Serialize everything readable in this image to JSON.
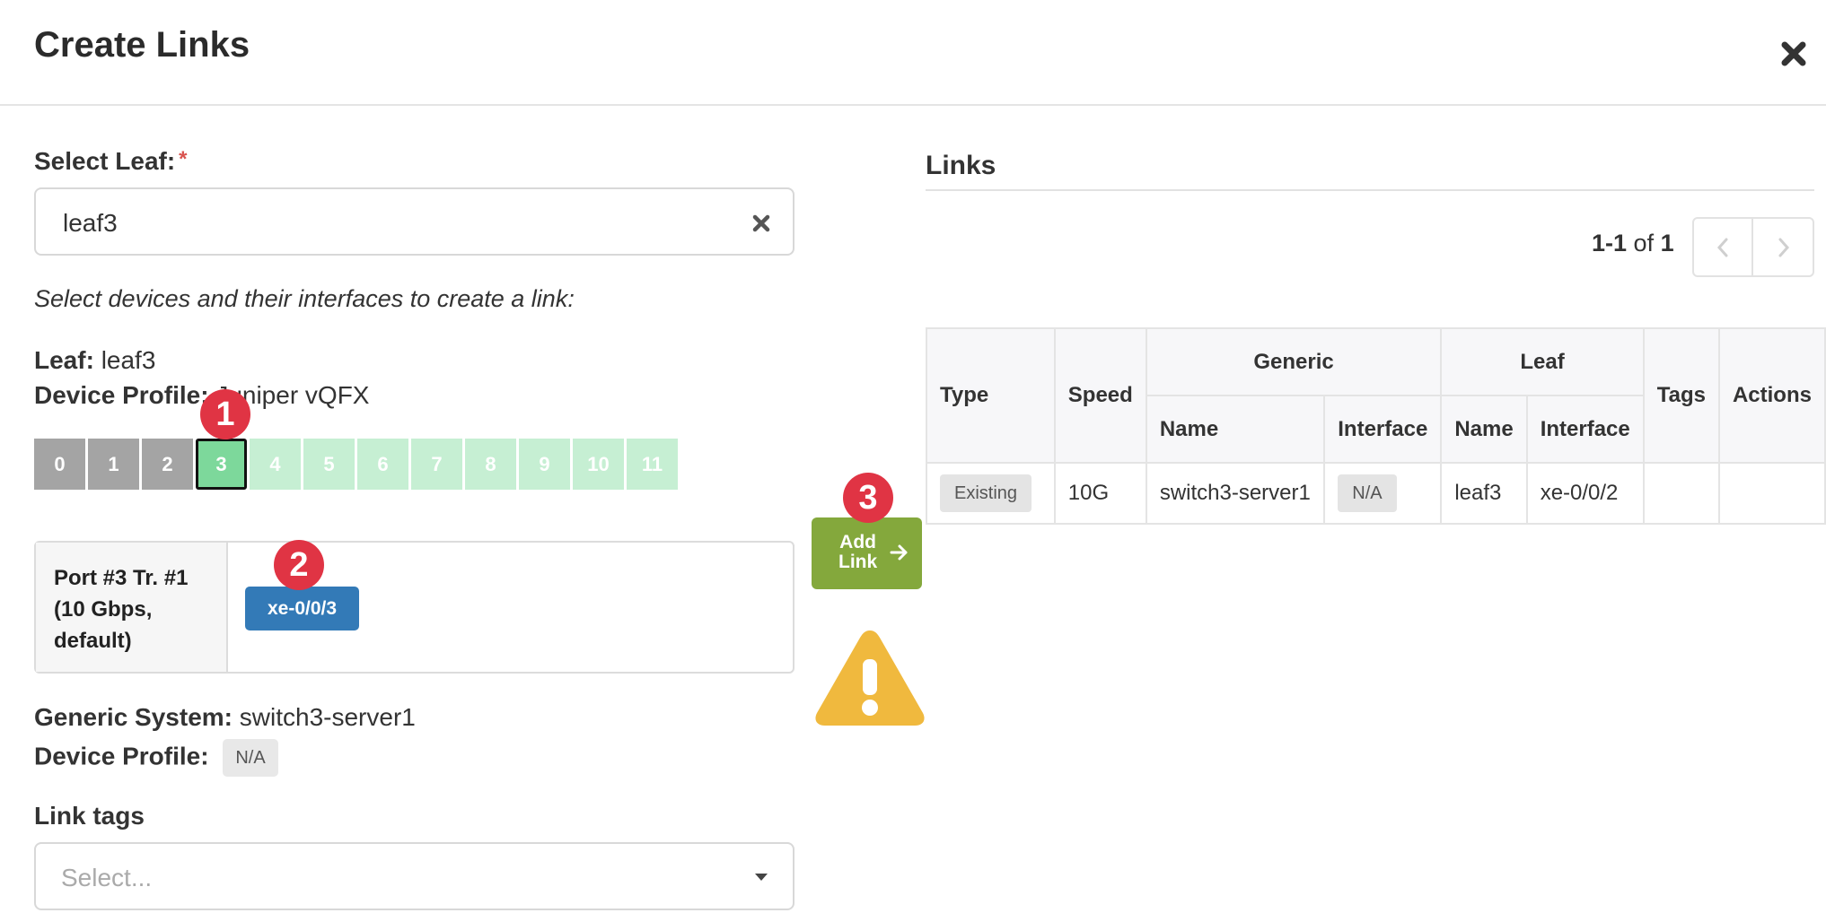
{
  "dialog": {
    "title": "Create Links"
  },
  "select_leaf": {
    "label": "Select Leaf:",
    "required_mark": "*",
    "value": "leaf3"
  },
  "instructions": "Select devices and their interfaces to create a link:",
  "leaf_info": {
    "leaf_label": "Leaf:",
    "leaf_value": "leaf3",
    "profile_label": "Device Profile:",
    "profile_value": "Juniper vQFX"
  },
  "ports": [
    {
      "label": "0",
      "state": "used"
    },
    {
      "label": "1",
      "state": "used"
    },
    {
      "label": "2",
      "state": "used"
    },
    {
      "label": "3",
      "state": "selected"
    },
    {
      "label": "4",
      "state": "free"
    },
    {
      "label": "5",
      "state": "free"
    },
    {
      "label": "6",
      "state": "free"
    },
    {
      "label": "7",
      "state": "free"
    },
    {
      "label": "8",
      "state": "free"
    },
    {
      "label": "9",
      "state": "free"
    },
    {
      "label": "10",
      "state": "free"
    },
    {
      "label": "11",
      "state": "free"
    }
  ],
  "step_badges": {
    "one": "1",
    "two": "2",
    "three": "3"
  },
  "port_panel": {
    "label_line1": "Port #3 Tr. #1",
    "label_line2": "(10 Gbps,",
    "label_line3": "default)",
    "interface": "xe-0/0/3"
  },
  "generic_info": {
    "system_label": "Generic System:",
    "system_value": "switch3-server1",
    "profile_label": "Device Profile:",
    "profile_value": "N/A"
  },
  "link_tags": {
    "label": "Link tags",
    "placeholder": "Select..."
  },
  "add_link": {
    "line1": "Add",
    "line2": "Link"
  },
  "links_panel": {
    "title": "Links",
    "pager_range": "1-1",
    "pager_of": "of",
    "pager_total": "1",
    "headers": {
      "type": "Type",
      "speed": "Speed",
      "generic": "Generic",
      "leaf": "Leaf",
      "tags": "Tags",
      "actions": "Actions",
      "generic_name": "Name",
      "generic_interface": "Interface",
      "leaf_name": "Name",
      "leaf_interface": "Interface"
    },
    "rows": [
      {
        "type": "Existing",
        "speed": "10G",
        "generic_name": "switch3-server1",
        "generic_interface": "N/A",
        "leaf_name": "leaf3",
        "leaf_interface": "xe-0/0/2",
        "tags": "",
        "actions": ""
      }
    ]
  },
  "colors": {
    "port_used": "#a4a4a4",
    "port_free": "#c6efd3",
    "port_selected": "#7dd89b",
    "interface_button": "#337ab7",
    "add_link_button": "#84a83c",
    "warning": "#f0b93e",
    "step_badge": "#e03444"
  },
  "icons": {
    "close": "close-icon",
    "clear": "clear-icon",
    "caret": "chevron-down-icon",
    "arrow": "arrow-right-icon",
    "warning": "warning-icon",
    "prev": "chevron-left-icon",
    "next": "chevron-right-icon"
  }
}
